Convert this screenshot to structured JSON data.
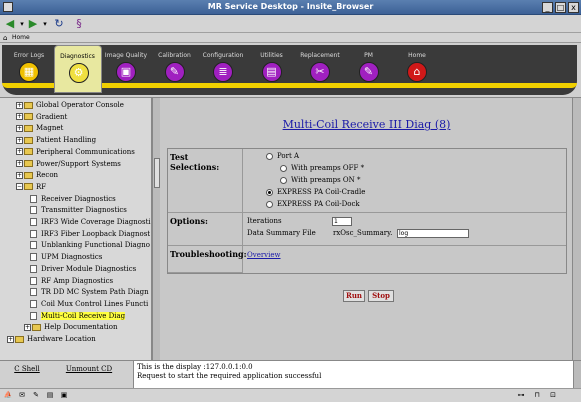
{
  "window": {
    "title": "MR Service Desktop - Insite_Browser",
    "minimize": "_",
    "maximize": "□",
    "close": "x"
  },
  "address": {
    "label": "Home"
  },
  "tabs": [
    {
      "label": "Error Logs",
      "color": "#f0c000",
      "glyph": "▦"
    },
    {
      "label": "Diagnostics",
      "color": "#f0e040",
      "glyph": "⚙",
      "active": true
    },
    {
      "label": "Image Quality",
      "color": "#a020c0",
      "glyph": "▣"
    },
    {
      "label": "Calibration",
      "color": "#a020c0",
      "glyph": "✎"
    },
    {
      "label": "Configuration",
      "color": "#a020c0",
      "glyph": "≣"
    },
    {
      "label": "Utilities",
      "color": "#a020c0",
      "glyph": "▤"
    },
    {
      "label": "Replacement",
      "color": "#a020c0",
      "glyph": "✂"
    },
    {
      "label": "PM",
      "color": "#a020c0",
      "glyph": "✎"
    },
    {
      "label": "Home",
      "color": "#d01818",
      "glyph": "⌂"
    }
  ],
  "tree": {
    "nodes": [
      {
        "label": "Global Operator Console",
        "type": "folder",
        "exp": "+"
      },
      {
        "label": "Gradient",
        "type": "folder",
        "exp": "+"
      },
      {
        "label": "Magnet",
        "type": "folder",
        "exp": "+"
      },
      {
        "label": "Patient Handling",
        "type": "folder",
        "exp": "+"
      },
      {
        "label": "Peripheral Communications",
        "type": "folder",
        "exp": "+"
      },
      {
        "label": "Power/Support Systems",
        "type": "folder",
        "exp": "+"
      },
      {
        "label": "Recon",
        "type": "folder",
        "exp": "+"
      },
      {
        "label": "RF",
        "type": "folder",
        "exp": "−"
      },
      {
        "label": "Receiver Diagnostics",
        "type": "doc"
      },
      {
        "label": "Transmitter Diagnostics",
        "type": "doc"
      },
      {
        "label": "IRF3 Wide Coverage Diagnosti",
        "type": "doc"
      },
      {
        "label": "IRF3 Fiber Loopback Diagnost",
        "type": "doc"
      },
      {
        "label": "Unblanking Functional Diagno",
        "type": "doc"
      },
      {
        "label": "UPM Diagnostics",
        "type": "doc"
      },
      {
        "label": "Driver Module Diagnostics",
        "type": "doc"
      },
      {
        "label": "RF Amp Diagnostics",
        "type": "doc"
      },
      {
        "label": "TR DD MC System Path Diagn",
        "type": "doc"
      },
      {
        "label": "Coil Mux Control Lines Functi",
        "type": "doc"
      },
      {
        "label": "Multi-Coil Receive Diag",
        "type": "doc",
        "selected": true
      },
      {
        "label": "Help Documentation",
        "type": "folder",
        "exp": "+",
        "indent": 1
      },
      {
        "label": "Hardware Location",
        "type": "folder",
        "exp": "+",
        "indent": 0
      }
    ]
  },
  "shell": {
    "cshell": "C Shell",
    "unmount": "Unmount CD"
  },
  "console": {
    "line1": "This is the display :127.0.0.1:0.0",
    "line2": "Request to start the required application successful"
  },
  "page": {
    "title": "Multi-Coil Receive III Diag (8)",
    "test_selections_label": "Test Selections:",
    "options_label": "Options:",
    "troubleshooting_label": "Troubleshooting:",
    "radios": [
      {
        "label": "Port A",
        "checked": false
      },
      {
        "label": "With preamps OFF *",
        "checked": false
      },
      {
        "label": "With preamps ON *",
        "checked": false
      },
      {
        "label": "EXPRESS PA Coil-Cradle",
        "checked": true
      },
      {
        "label": "EXPRESS PA Coil-Dock",
        "checked": false
      }
    ],
    "iterations_label": "Iterations",
    "iterations_value": "1",
    "summary_label": "Data Summary File",
    "summary_prefix": "rxOsc_Summary.",
    "summary_value": "log",
    "overview_link": "Overview",
    "run_label": "Run",
    "stop_label": "Stop"
  }
}
